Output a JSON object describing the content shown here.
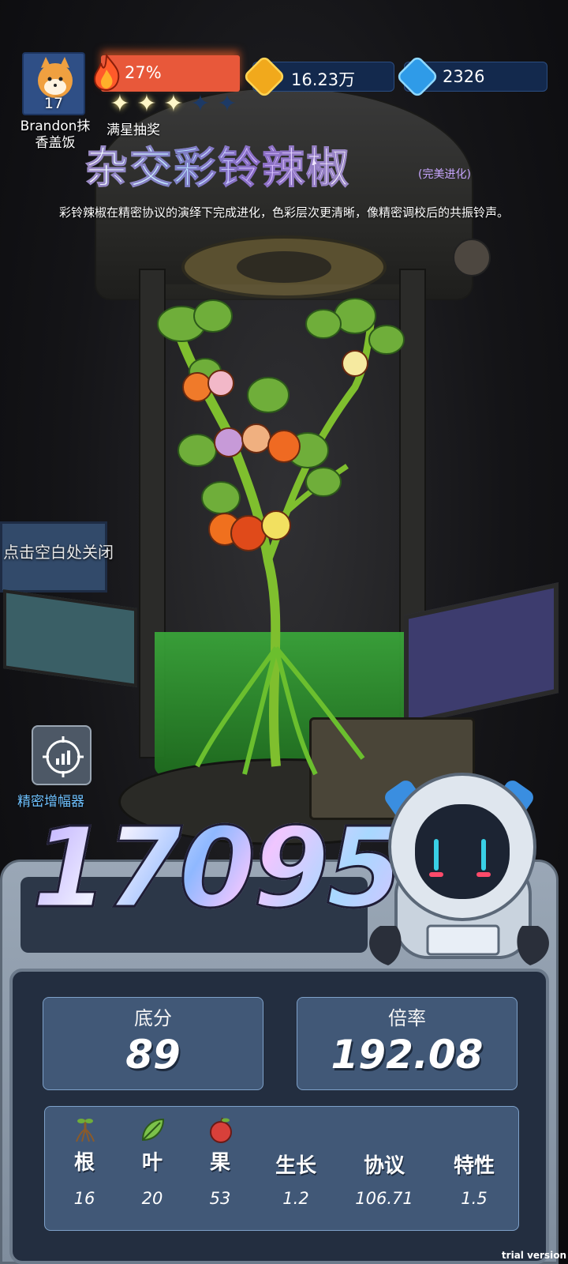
{
  "player": {
    "level": "17",
    "name_line1": "Brandon抹",
    "name_line2": "香盖饭"
  },
  "progress": {
    "percent_label": "27%",
    "value": 0.27,
    "stars_filled": 3,
    "stars_total": 5,
    "stars_label": "满星抽奖"
  },
  "currency": {
    "gold": "16.23万",
    "gems": "2326"
  },
  "plant": {
    "name": "杂交彩铃辣椒",
    "tag": "(完美进化)",
    "description": "彩铃辣椒在精密协议的演绎下完成进化，色彩层次更清晰，像精密调校后的共振铃声。"
  },
  "hint": {
    "tap_close": "点击空白处关闭"
  },
  "amplifier": {
    "label": "精密增幅器",
    "icon": "target-chart-icon"
  },
  "score": {
    "total": "17095",
    "base_label": "底分",
    "base_value": "89",
    "multiplier_label": "倍率",
    "multiplier_value": "192.08"
  },
  "stats": [
    {
      "label": "根",
      "value": "16",
      "icon": "root-icon"
    },
    {
      "label": "叶",
      "value": "20",
      "icon": "leaf-icon"
    },
    {
      "label": "果",
      "value": "53",
      "icon": "fruit-icon"
    },
    {
      "label": "生长",
      "value": "1.2"
    },
    {
      "label": "协议",
      "value": "106.71"
    },
    {
      "label": "特性",
      "value": "1.5"
    }
  ],
  "watermark": "trial version",
  "colors": {
    "fire_bar": "#e8583a",
    "gold_accent": "#f1a91c",
    "gem_accent": "#2f9be8",
    "stat_box": "#415877",
    "liquid": "#3aa83a",
    "amp_label": "#6ec1ff"
  }
}
